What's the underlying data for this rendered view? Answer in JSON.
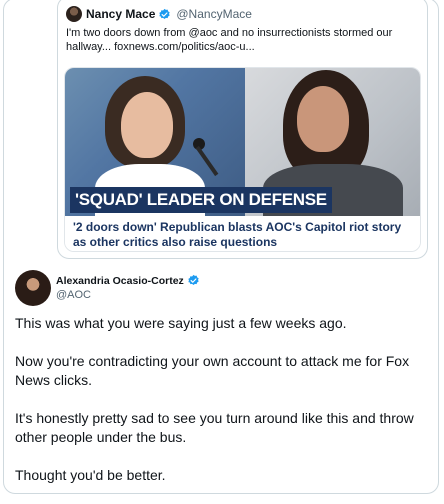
{
  "quoted_tweet": {
    "author_name": "Nancy Mace",
    "author_handle": "@NancyMace",
    "text": "I'm two doors down from @aoc and no insurrectionists stormed our hallway... foxnews.com/politics/aoc-u...",
    "media": {
      "banner": "'SQUAD' LEADER ON DEFENSE",
      "caption": "'2 doors down' Republican blasts AOC's Capitol riot story as other critics also raise questions"
    }
  },
  "tweet": {
    "author_name": "Alexandria Ocasio-Cortez",
    "author_handle": "@AOC",
    "paragraphs": [
      "This was what you were saying just a few weeks ago.",
      "Now you're contradicting your own account to attack me for Fox News clicks.",
      "It's honestly pretty sad to see you turn around like this and throw other people under the bus.",
      "Thought you'd be better."
    ]
  },
  "colors": {
    "verified": "#1d9bf0",
    "banner_bg": "#1b3561",
    "border": "#cfd9de"
  },
  "icons": {
    "verified": "verified-badge-icon"
  }
}
